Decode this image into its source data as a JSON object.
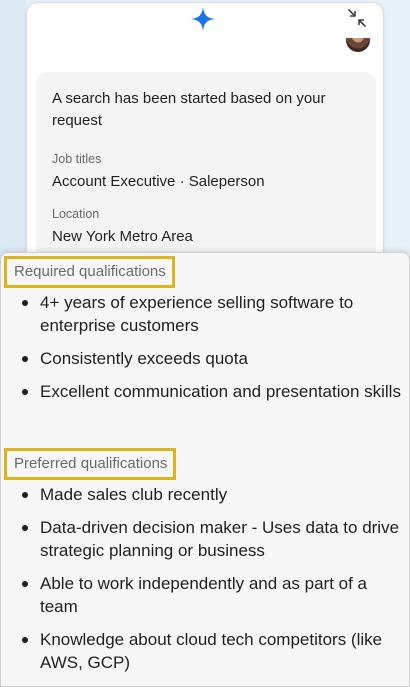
{
  "chat": {
    "message": "A search has been started based on your request",
    "fields": [
      {
        "label": "Job titles",
        "value": "Account Executive · Saleperson"
      },
      {
        "label": "Location",
        "value": "New York Metro Area"
      }
    ]
  },
  "qualifications": {
    "required": {
      "heading": "Required qualifications",
      "items": [
        "4+ years of experience selling software to enterprise customers",
        "Consistently exceeds quota",
        "Excellent communication and presentation skills"
      ]
    },
    "preferred": {
      "heading": "Preferred qualifications",
      "items": [
        "Made sales club recently",
        "Data-driven decision maker - Uses data to drive strategic planning or business",
        "Able to work independently and as part of a team",
        "Knowledge about cloud tech competitors (like AWS, GCP)"
      ]
    }
  },
  "colors": {
    "highlight_border": "#dcb51c",
    "sparkle": "#1a73e8"
  },
  "icons": {
    "logo": "sparkle-icon",
    "minimize": "minimize-icon"
  }
}
